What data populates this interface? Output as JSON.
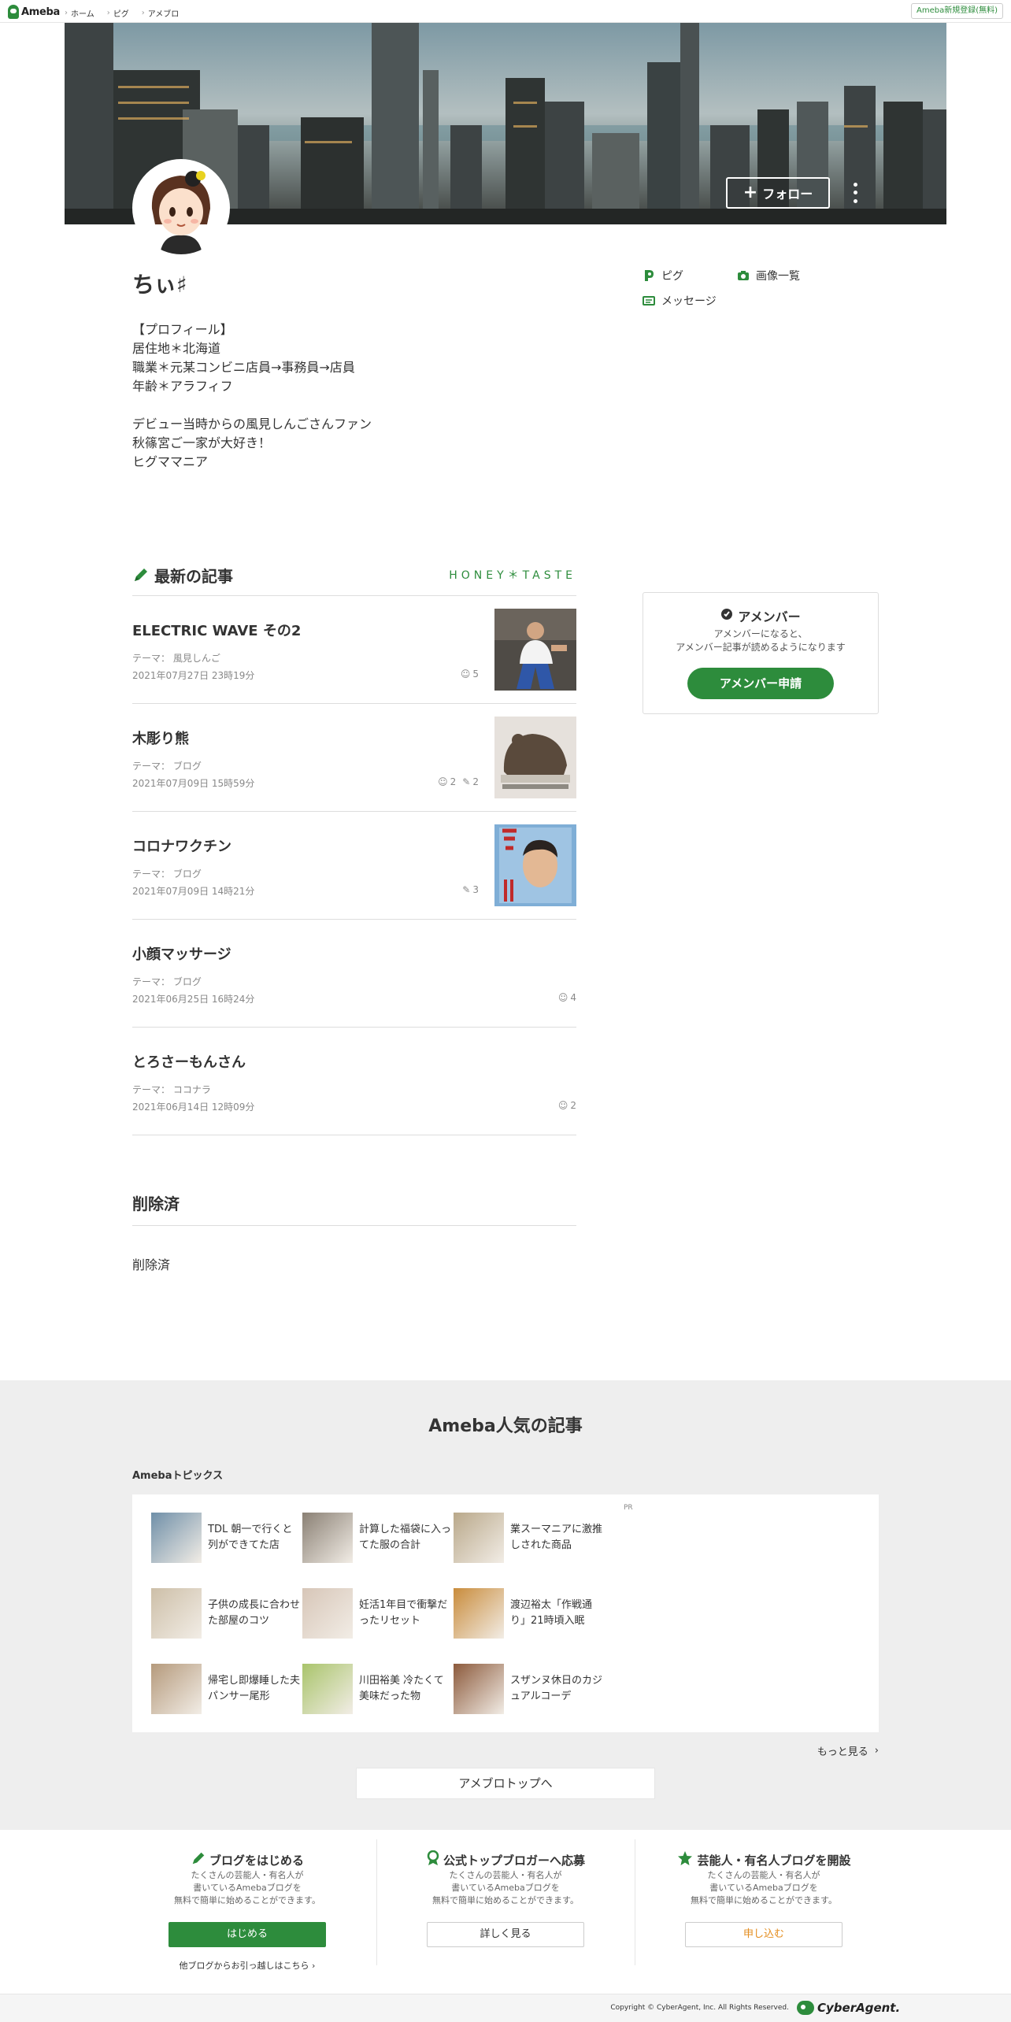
{
  "topbar": {
    "logo": "Ameba",
    "nav": [
      "ホーム",
      "ピグ",
      "アメブロ"
    ],
    "register": "Ameba新規登録(無料)"
  },
  "cover": {
    "follow_label": "フォロー"
  },
  "profile": {
    "name": "ちぃ♯",
    "text": "【プロフィール】\n居住地＊北海道\n職業＊元某コンビニ店員→事務員→店員\n年齢＊アラフィフ\n\nデビュー当時からの風見しんごさんファン\n秋篠宮ご一家が大好き！\nヒグママニア"
  },
  "side_links": {
    "pigg": "ピグ",
    "images": "画像一覧",
    "message": "メッセージ"
  },
  "latest": {
    "title": "最新の記事",
    "blog_name": "HONEY＊TASTE",
    "articles": [
      {
        "title": "ELECTRIC WAVE その2",
        "theme": "テーマ：  風見しんご",
        "date": "2021年07月27日 23時19分",
        "likes": "5",
        "comments": ""
      },
      {
        "title": "木彫り熊",
        "theme": "テーマ：  ブログ",
        "date": "2021年07月09日 15時59分",
        "likes": "2",
        "comments": "2"
      },
      {
        "title": "コロナワクチン",
        "theme": "テーマ：  ブログ",
        "date": "2021年07月09日 14時21分",
        "likes": "",
        "comments": "3"
      },
      {
        "title": "小顔マッサージ",
        "theme": "テーマ：  ブログ",
        "date": "2021年06月25日 16時24分",
        "likes": "4",
        "comments": ""
      },
      {
        "title": "とろさーもんさん",
        "theme": "テーマ：  ココナラ",
        "date": "2021年06月14日 12時09分",
        "likes": "2",
        "comments": ""
      }
    ]
  },
  "deleted": {
    "title": "削除済",
    "body": "削除済"
  },
  "member": {
    "title": "アメンバー",
    "desc": "アメンバーになると、\nアメンバー記事が読めるようになります",
    "button": "アメンバー申請"
  },
  "popular": {
    "title": "Ameba人気の記事",
    "subtitle": "Amebaトピックス",
    "pr": "PR",
    "topics": [
      {
        "text": "TDL 朝一で行くと列ができてた店",
        "color": "#6f8fa8"
      },
      {
        "text": "計算した福袋に入ってた服の合計",
        "color": "#8a8074"
      },
      {
        "text": "業スーマニアに激推しされた商品",
        "color": "#b9a88a"
      },
      {
        "text": "子供の成長に合わせた部屋のコツ",
        "color": "#cdbfa8"
      },
      {
        "text": "妊活1年目で衝撃だったリセット",
        "color": "#d7c6b8"
      },
      {
        "text": "渡辺裕太「作戦通り」21時頃入眠",
        "color": "#c98c3c"
      },
      {
        "text": "帰宅し即爆睡した夫パンサー尾形",
        "color": "#b59a7c"
      },
      {
        "text": "川田裕美 冷たくて美味だった物",
        "color": "#a9c46b"
      },
      {
        "text": "スザンヌ休日のカジュアルコーデ",
        "color": "#8c5a3c"
      }
    ],
    "more": "もっと見る",
    "top_button": "アメブロトップへ"
  },
  "cta": [
    {
      "title": "ブログをはじめる",
      "desc": "たくさんの芸能人・有名人が\n書いているAmebaブログを\n無料で簡単に始めることができます。",
      "button": "はじめる",
      "link": "他ブログからお引っ越しはこちら"
    },
    {
      "title": "公式トップブロガーへ応募",
      "desc": "たくさんの芸能人・有名人が\n書いているAmebaブログを\n無料で簡単に始めることができます。",
      "button": "詳しく見る"
    },
    {
      "title": "芸能人・有名人ブログを開設",
      "desc": "たくさんの芸能人・有名人が\n書いているAmebaブログを\n無料で簡単に始めることができます。",
      "button": "申し込む"
    }
  ],
  "footer": {
    "copyright": "Copyright © CyberAgent, Inc. All Rights Reserved.",
    "company": "CyberAgent."
  },
  "colors": {
    "accent": "#2d8c3c",
    "orange": "#e38b1b"
  }
}
